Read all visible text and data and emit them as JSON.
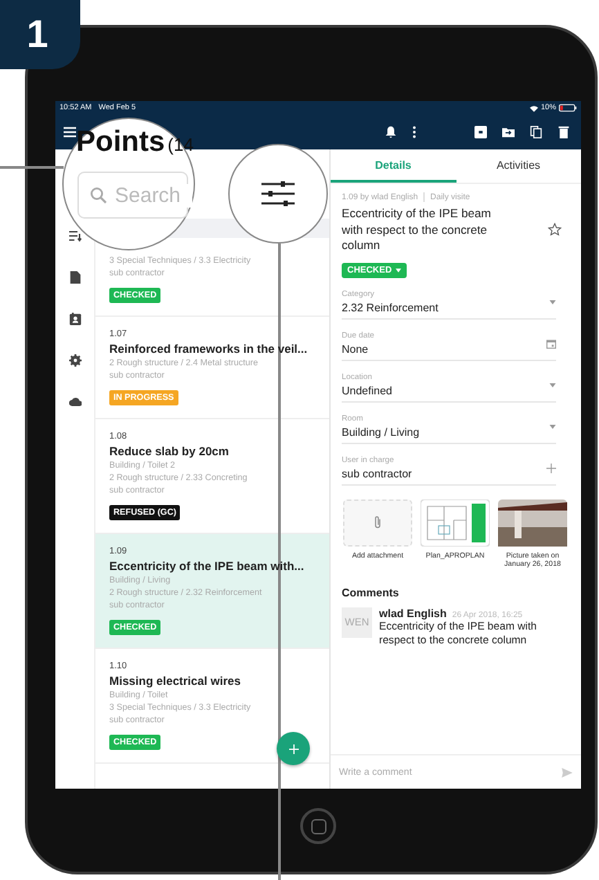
{
  "step_badge": "1",
  "status_bar": {
    "time": "10:52 AM",
    "date": "Wed Feb 5",
    "battery": "10%"
  },
  "list_header": {
    "title": "Points",
    "count": "(14",
    "search": {
      "placeholder": "Search"
    }
  },
  "points": [
    {
      "lines": [
        "3 Special Techniques / 3.3 Electricity",
        "sub contractor"
      ],
      "status": {
        "label": "CHECKED",
        "color": "#1eb854"
      },
      "selected": false
    },
    {
      "number": "1.07",
      "title": "Reinforced frameworks in the veil...",
      "lines": [
        "2 Rough structure / 2.4 Metal structure",
        "sub contractor"
      ],
      "status": {
        "label": "IN PROGRESS",
        "color": "#f5a623"
      },
      "selected": false
    },
    {
      "number": "1.08",
      "title": "Reduce slab by 20cm",
      "lines": [
        "Building / Toilet 2",
        "2 Rough structure / 2.33 Concreting",
        "sub contractor"
      ],
      "status": {
        "label": "REFUSED (GC)",
        "color": "#111111"
      },
      "selected": false
    },
    {
      "number": "1.09",
      "title": "Eccentricity of the IPE beam with...",
      "lines": [
        "Building / Living",
        "2 Rough structure / 2.32 Reinforcement",
        "sub contractor"
      ],
      "status": {
        "label": "CHECKED",
        "color": "#1eb854"
      },
      "selected": true
    },
    {
      "number": "1.10",
      "title": "Missing electrical wires",
      "lines": [
        "Building / Toilet",
        "3 Special Techniques / 3.3 Electricity",
        "sub contractor"
      ],
      "status": {
        "label": "CHECKED",
        "color": "#1eb854"
      },
      "selected": false
    }
  ],
  "detail": {
    "tabs": [
      {
        "label": "Details",
        "selected": true
      },
      {
        "label": "Activities",
        "selected": false
      }
    ],
    "meta": "1.09 by wlad English",
    "visit": "Daily visite",
    "title": "Eccentricity of the IPE beam with respect to the concrete column",
    "status": "CHECKED",
    "fields": [
      {
        "label": "Category",
        "value": "2.32 Reinforcement",
        "kind": "dropdown"
      },
      {
        "label": "Due date",
        "value": "None",
        "kind": "date"
      },
      {
        "label": "Location",
        "value": "Undefined",
        "kind": "dropdown"
      },
      {
        "label": "Room",
        "value": "Building / Living",
        "kind": "dropdown"
      },
      {
        "label": "User in charge",
        "value": "sub contractor",
        "kind": "add"
      }
    ],
    "attachments": [
      {
        "kind": "add",
        "caption": "Add attachment"
      },
      {
        "kind": "plan",
        "caption": "Plan_APROPLAN"
      },
      {
        "kind": "photo",
        "caption": "Picture taken on January 26, 2018"
      }
    ],
    "comments_title": "Comments",
    "comments": [
      {
        "initials": "WEN",
        "author": "wlad English",
        "time": "26 Apr 2018, 16:25",
        "text": "Eccentricity of the IPE beam with respect to the concrete column"
      }
    ],
    "comment_input": {
      "placeholder": "Write a comment"
    }
  }
}
